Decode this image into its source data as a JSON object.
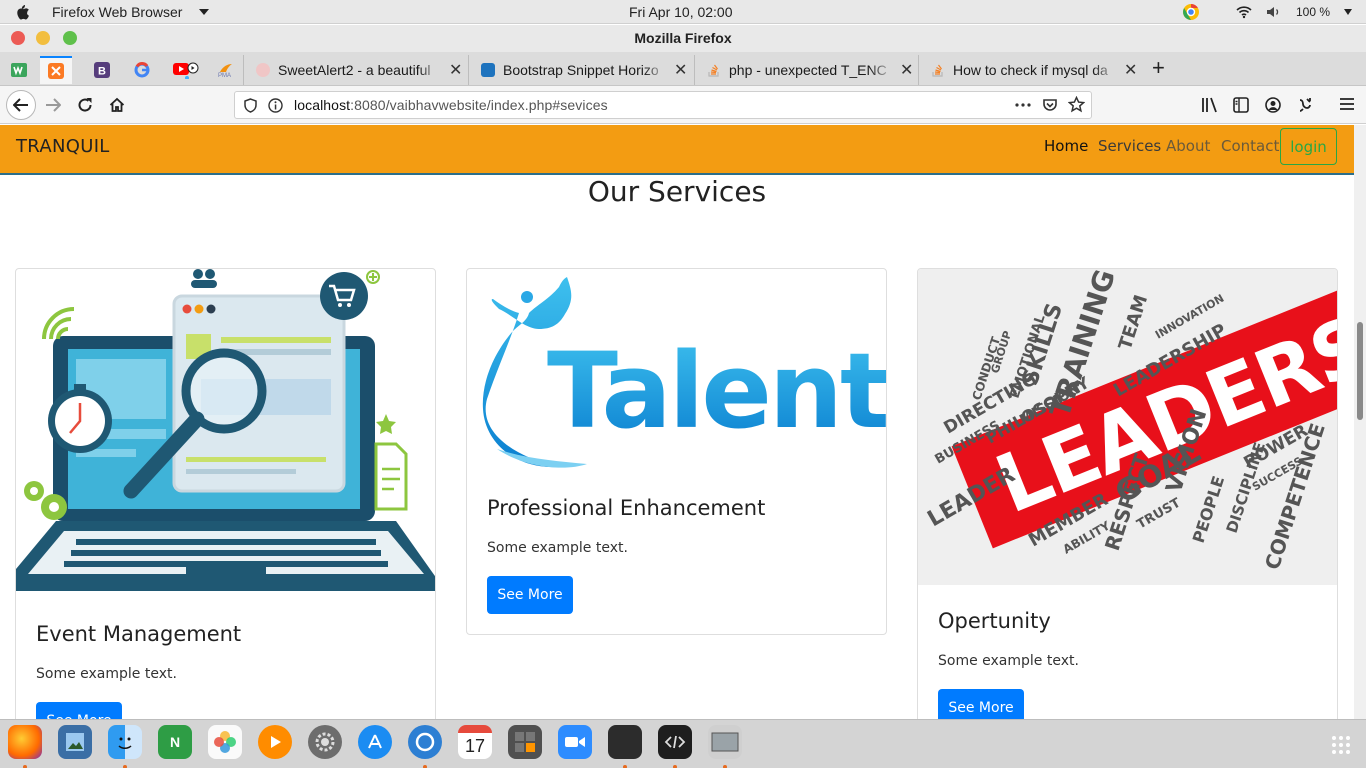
{
  "system": {
    "app_name": "Firefox Web Browser",
    "clock": "Fri Apr 10, 02:00",
    "battery": "100 %"
  },
  "window": {
    "title": "Mozilla Firefox"
  },
  "tabs": [
    {
      "title": "SweetAlert2 - a beautiful",
      "favicon_color": "#e8a0a0"
    },
    {
      "title": "Bootstrap Snippet Horizo",
      "favicon_color": "#1e73be"
    },
    {
      "title": "php - unexpected T_ENC",
      "favicon_color": "#f48024"
    },
    {
      "title": "How to check if mysql da",
      "favicon_color": "#f48024"
    }
  ],
  "address_bar": {
    "host": "localhost",
    "rest": ":8080/vaibhavwebsite/index.php#sevices"
  },
  "site": {
    "brand": "TRANQUIL",
    "nav": {
      "home": "Home",
      "services": "Services",
      "about": "About",
      "contact": "Contact",
      "login": "login"
    },
    "section_title": "Our Services",
    "cards": [
      {
        "title": "Event Management",
        "text": "Some example text.",
        "button": "See More"
      },
      {
        "title": "Professional Enhancement",
        "text": "Some example text.",
        "button": "See More",
        "image_word": "Talent"
      },
      {
        "title": "Opertunity",
        "text": "Some example text.",
        "button": "See More",
        "image_word": "LEADERSHIP"
      }
    ],
    "wordcloud": [
      "TRAINING",
      "SKILLS",
      "TEAM",
      "LEADERSHIP",
      "MISSION",
      "PHILOSOPHY",
      "DIRECTING",
      "BUSINESS",
      "LEADER",
      "MEMBER",
      "RESPECT",
      "GOAL",
      "VISION",
      "PEOPLE",
      "TRUST",
      "COMPETENCE",
      "POWER",
      "SUCCESS",
      "INNOVATION",
      "DISCIPLINE",
      "CONDUCT",
      "EMOTIONAL",
      "GROUP",
      "ABILITY"
    ]
  },
  "dock": {
    "calendar_day": "17",
    "notes_letter": "N"
  },
  "colors": {
    "site_navbar": "#f39c12",
    "primary_button": "#007bff",
    "login_outline": "#28a745",
    "leadership_red": "#e8101a"
  }
}
